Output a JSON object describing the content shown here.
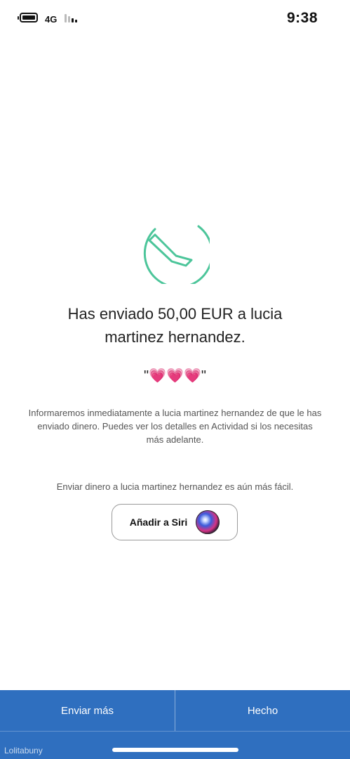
{
  "status_bar": {
    "time": "9:38",
    "network": "4G"
  },
  "confirmation": {
    "headline": "Has enviado 50,00 EUR a lucia martinez hernandez.",
    "note": "\"💗💗💗\"",
    "info": "Informaremos inmediatamente a lucia martinez hernandez de que le has enviado dinero. Puedes ver los detalles en Actividad si los necesitas más adelante.",
    "check_color": "#4cc59a"
  },
  "siri": {
    "hint": "Enviar dinero a lucia martinez hernandez es aún más fácil.",
    "button_label": "Añadir a Siri",
    "icon": "siri-icon"
  },
  "bottom_bar": {
    "left_label": "Enviar más",
    "right_label": "Hecho",
    "color": "#2f6fbf"
  },
  "watermark": "Lolitabuny"
}
